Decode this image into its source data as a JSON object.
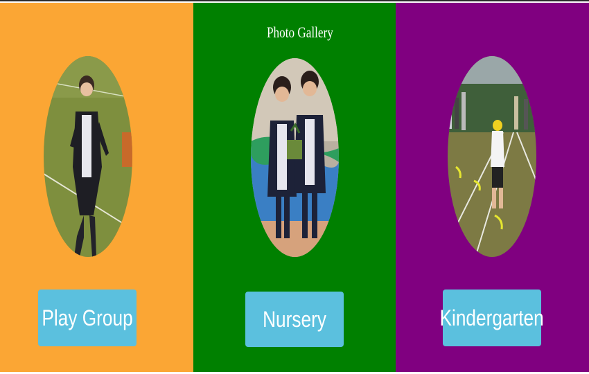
{
  "header": {
    "title": "Photo Gallery"
  },
  "panels": [
    {
      "label": "Play Group",
      "color": "#fba634"
    },
    {
      "label": "Nursery",
      "color": "#008000"
    },
    {
      "label": "Kindergarten",
      "color": "#800080"
    }
  ],
  "colors": {
    "button": "#5bc0de",
    "button_text": "#ffffff"
  }
}
